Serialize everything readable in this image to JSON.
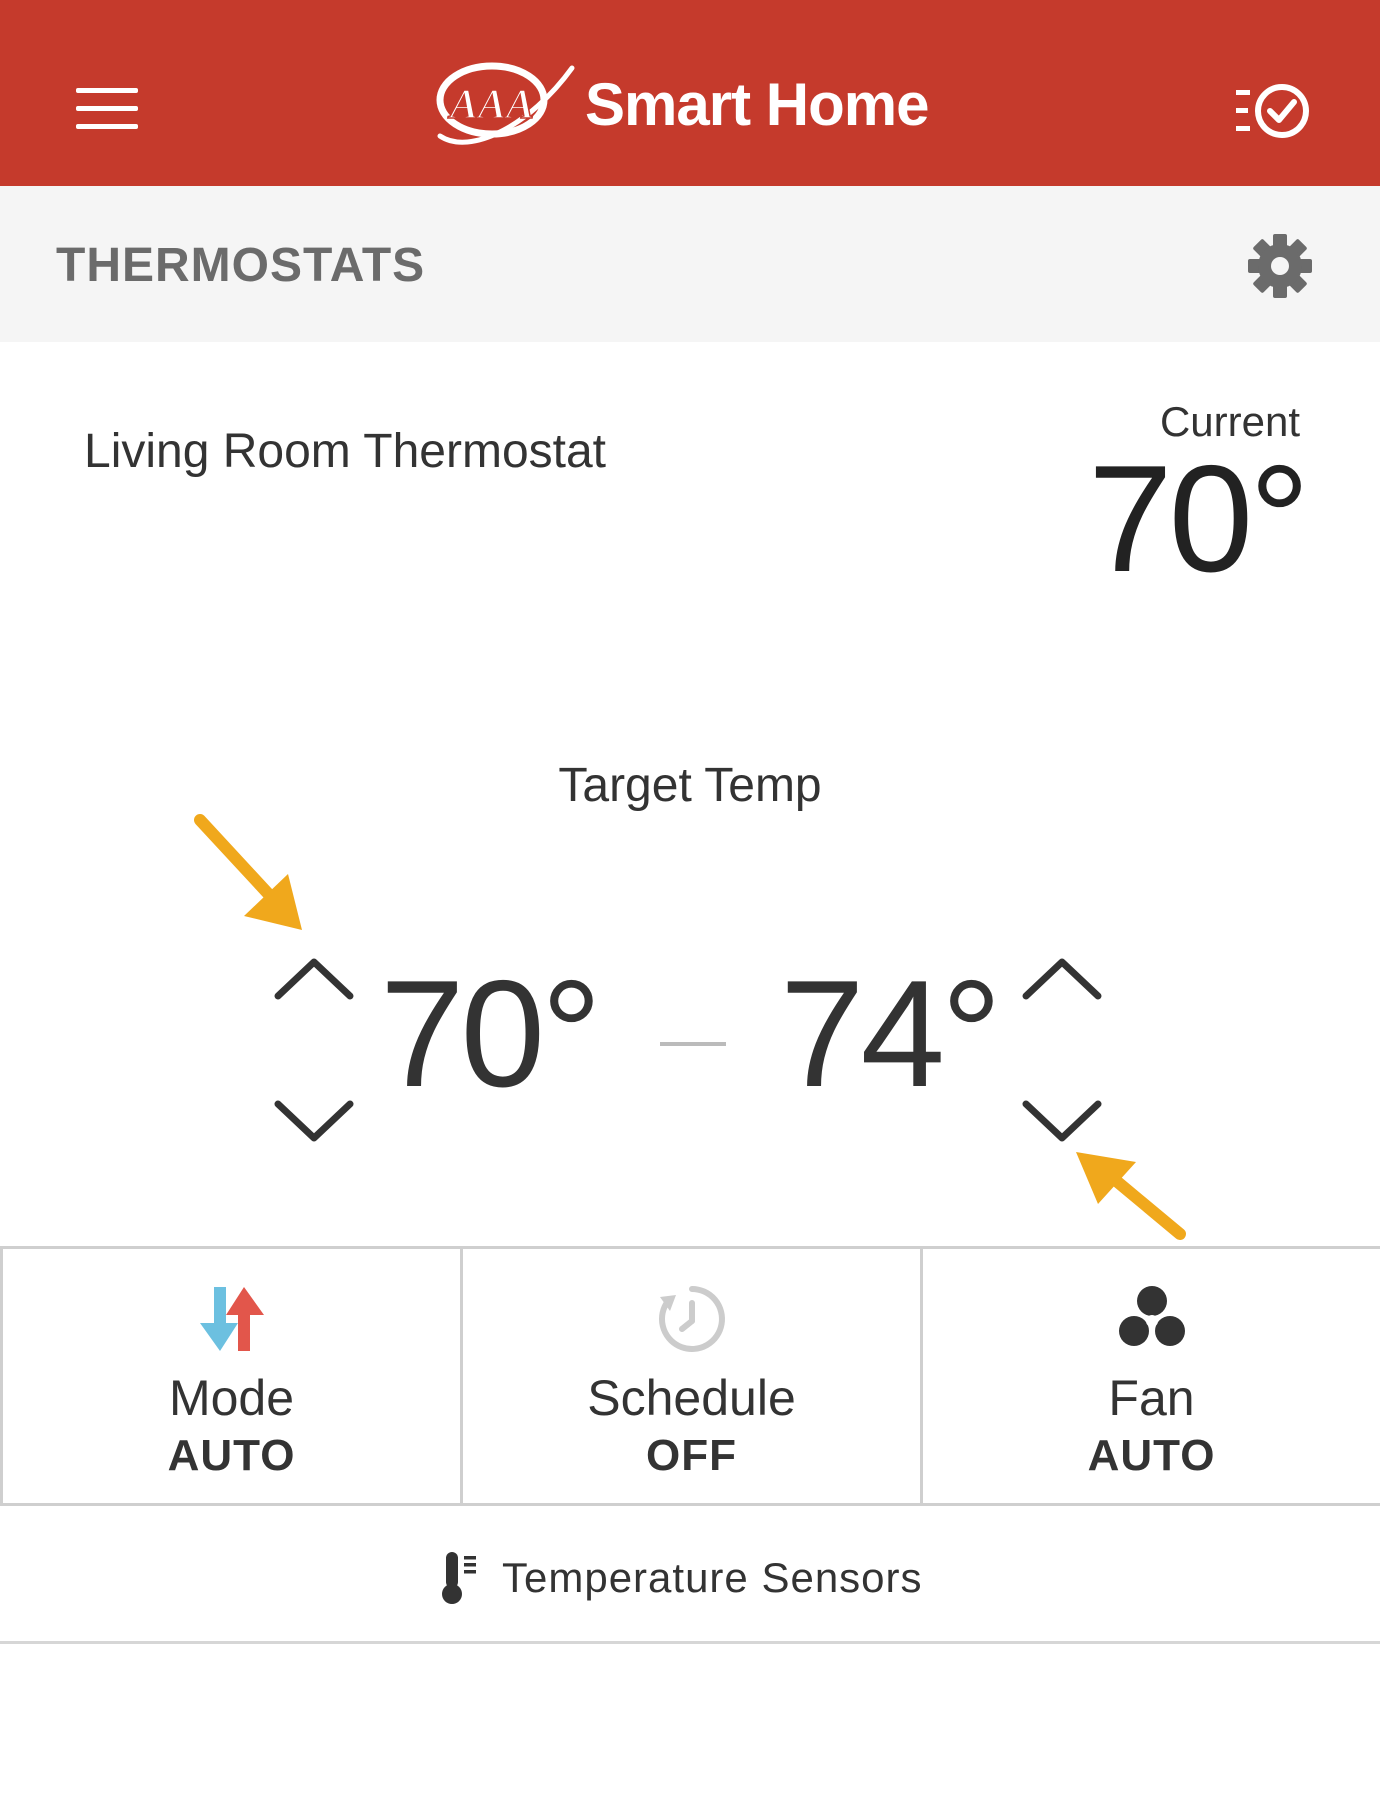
{
  "header": {
    "brand_text": "Smart Home",
    "logo_text": "AAA",
    "color": "#c53a2c",
    "menu_icon": "hamburger-icon",
    "tasks_icon": "checklist-icon"
  },
  "section": {
    "title": "THERMOSTATS",
    "settings_icon": "gear-icon"
  },
  "device": {
    "name": "Living Room Thermostat",
    "current_label": "Current",
    "current_temp": "70°"
  },
  "target": {
    "label": "Target Temp",
    "low": "70°",
    "high": "74°"
  },
  "controls": [
    {
      "label": "Mode",
      "value": "AUTO",
      "icon": "heat-cool-arrows-icon"
    },
    {
      "label": "Schedule",
      "value": "OFF",
      "icon": "clock-icon"
    },
    {
      "label": "Fan",
      "value": "AUTO",
      "icon": "fan-icon"
    }
  ],
  "sensors": {
    "label": "Temperature Sensors",
    "icon": "thermometer-icon"
  },
  "annotation_color": "#f0a81c"
}
